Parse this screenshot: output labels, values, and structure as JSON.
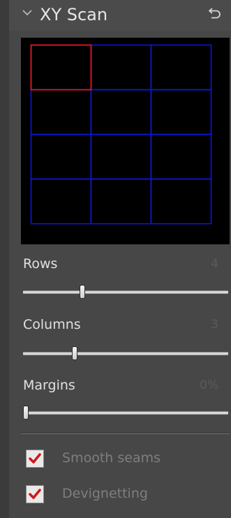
{
  "panel": {
    "title": "XY Scan",
    "collapse_icon": "chevron-down-icon",
    "reset_icon": "undo-arrow-icon"
  },
  "preview": {
    "rows": 4,
    "columns": 3,
    "selected_cell": {
      "row": 1,
      "column": 1
    },
    "grid_color": "#0a18d6",
    "selected_color": "#e01818",
    "background": "#000000"
  },
  "sliders": {
    "rows": {
      "label": "Rows",
      "value": "4",
      "fraction": 0.29
    },
    "columns": {
      "label": "Columns",
      "value": "3",
      "fraction": 0.25
    },
    "margins": {
      "label": "Margins",
      "value": "0%",
      "fraction": 0.0
    }
  },
  "options": {
    "smooth_seams": {
      "label": "Smooth seams",
      "checked": true
    },
    "devignetting": {
      "label": "Devignetting",
      "checked": true
    }
  },
  "colors": {
    "panel_bg": "#474747",
    "check_mark": "#d01818"
  }
}
